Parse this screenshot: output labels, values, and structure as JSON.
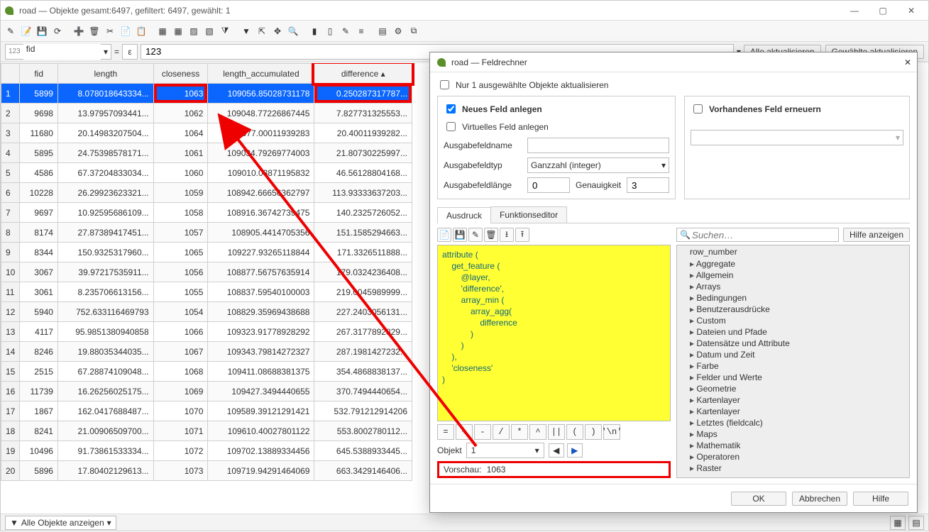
{
  "title": "road — Objekte gesamt:6497, gefiltert: 6497, gewählt: 1",
  "expr_field_prefix": "123",
  "expr_field_name": "fid",
  "expr_value": "123",
  "btn_update_all": "Alle aktualisieren",
  "btn_update_selected": "Gewählte aktualisieren",
  "columns": [
    "fid",
    "length",
    "closeness",
    "length_accumulated",
    "difference"
  ],
  "rows": [
    {
      "n": "1",
      "fid": "5899",
      "length": "8.078018643334...",
      "closeness": "1063",
      "la": "109056.85028731178",
      "diff": "0.250287317787..."
    },
    {
      "n": "2",
      "fid": "9698",
      "length": "13.97957093441...",
      "closeness": "1062",
      "la": "109048.77226867445",
      "diff": "7.827731325553..."
    },
    {
      "n": "3",
      "fid": "11680",
      "length": "20.14983207504...",
      "closeness": "1064",
      "la": "109077.00011939283",
      "diff": "20.40011939282..."
    },
    {
      "n": "4",
      "fid": "5895",
      "length": "24.75398578171...",
      "closeness": "1061",
      "la": "109034.79269774003",
      "diff": "21.80730225997..."
    },
    {
      "n": "5",
      "fid": "4586",
      "length": "67.37204833034...",
      "closeness": "1060",
      "la": "109010.03871195832",
      "diff": "46.56128804168..."
    },
    {
      "n": "6",
      "fid": "10228",
      "length": "26.29923623321...",
      "closeness": "1059",
      "la": "108942.66656362797",
      "diff": "113.93333637203..."
    },
    {
      "n": "7",
      "fid": "9697",
      "length": "10.92595686109...",
      "closeness": "1058",
      "la": "108916.36742739475",
      "diff": "140.2325726052..."
    },
    {
      "n": "8",
      "fid": "8174",
      "length": "27.87389417451...",
      "closeness": "1057",
      "la": "108905.4414705356",
      "diff": "151.1585294663..."
    },
    {
      "n": "9",
      "fid": "8344",
      "length": "150.9325317960...",
      "closeness": "1065",
      "la": "109227.93265118844",
      "diff": "171.3326511888..."
    },
    {
      "n": "10",
      "fid": "3067",
      "length": "39.97217535911...",
      "closeness": "1056",
      "la": "108877.56757635914",
      "diff": "179.0324236408..."
    },
    {
      "n": "11",
      "fid": "3061",
      "length": "8.235706613156...",
      "closeness": "1055",
      "la": "108837.59540100003",
      "diff": "219.0045989999..."
    },
    {
      "n": "12",
      "fid": "5940",
      "length": "752.633116469793",
      "closeness": "1054",
      "la": "108829.35969438688",
      "diff": "227.2403056131..."
    },
    {
      "n": "13",
      "fid": "4117",
      "length": "95.9851380940858",
      "closeness": "1066",
      "la": "109323.91778928292",
      "diff": "267.3177892829..."
    },
    {
      "n": "14",
      "fid": "8246",
      "length": "19.88035344035...",
      "closeness": "1067",
      "la": "109343.79814272327",
      "diff": "287.1981427232..."
    },
    {
      "n": "15",
      "fid": "2515",
      "length": "67.28874109048...",
      "closeness": "1068",
      "la": "109411.08688381375",
      "diff": "354.4868838137..."
    },
    {
      "n": "16",
      "fid": "11739",
      "length": "16.26256025175...",
      "closeness": "1069",
      "la": "109427.3494440655",
      "diff": "370.7494440654..."
    },
    {
      "n": "17",
      "fid": "1867",
      "length": "162.0417688487...",
      "closeness": "1070",
      "la": "109589.39121291421",
      "diff": "532.791212914206"
    },
    {
      "n": "18",
      "fid": "8241",
      "length": "21.00906509700...",
      "closeness": "1071",
      "la": "109610.40027801122",
      "diff": "553.8002780112..."
    },
    {
      "n": "19",
      "fid": "10496",
      "length": "91.73861533334...",
      "closeness": "1072",
      "la": "109702.13889334456",
      "diff": "645.5388933445..."
    },
    {
      "n": "20",
      "fid": "5896",
      "length": "17.80402129613...",
      "closeness": "1073",
      "la": "109719.94291464069",
      "diff": "663.3429146406..."
    }
  ],
  "status_left": "Alle Objekte anzeigen",
  "dialog": {
    "title": "road — Feldrechner",
    "chk_only_selected": "Nur 1 ausgewählte Objekte aktualisieren",
    "chk_new_field": "Neues Feld anlegen",
    "chk_existing": "Vorhandenes Feld erneuern",
    "chk_virtual": "Virtuelles Feld anlegen",
    "lbl_outname": "Ausgabefeldname",
    "lbl_outtype": "Ausgabefeldtyp",
    "val_outtype": "Ganzzahl (integer)",
    "lbl_outlen": "Ausgabefeldlänge",
    "val_outlen": "0",
    "lbl_prec": "Genauigkeit",
    "val_prec": "3",
    "tab_expr": "Ausdruck",
    "tab_func": "Funktionseditor",
    "code_line1": "attribute (",
    "code_line2": "    get_feature (",
    "code_line3": "        @layer,",
    "code_line4": "        'difference',",
    "code_line5": "        array_min (",
    "code_line6": "            array_agg(",
    "code_line7": "                difference",
    "code_line8": "            )",
    "code_line9": "        )",
    "code_line10": "    ),",
    "code_line11": "    'closeness'",
    "code_line12": ")",
    "ops": [
      "=",
      "+",
      "-",
      "/",
      "*",
      "^",
      "||",
      "(",
      ")",
      "'\\n'"
    ],
    "obj_label": "Objekt",
    "obj_value": "1",
    "preview_label": "Vorschau:",
    "preview_value": "1063",
    "search_placeholder": "Suchen…",
    "help_btn": "Hilfe anzeigen",
    "func_header": "row_number",
    "func_groups": [
      "Aggregate",
      "Allgemein",
      "Arrays",
      "Bedingungen",
      "Benutzerausdrücke",
      "Custom",
      "Dateien und Pfade",
      "Datensätze und Attribute",
      "Datum und Zeit",
      "Farbe",
      "Felder und Werte",
      "Geometrie",
      "Kartenlayer",
      "Kartenlayer",
      "Letztes (fieldcalc)",
      "Maps",
      "Mathematik",
      "Operatoren",
      "Raster"
    ],
    "btn_ok": "OK",
    "btn_cancel": "Abbrechen",
    "btn_help": "Hilfe"
  }
}
